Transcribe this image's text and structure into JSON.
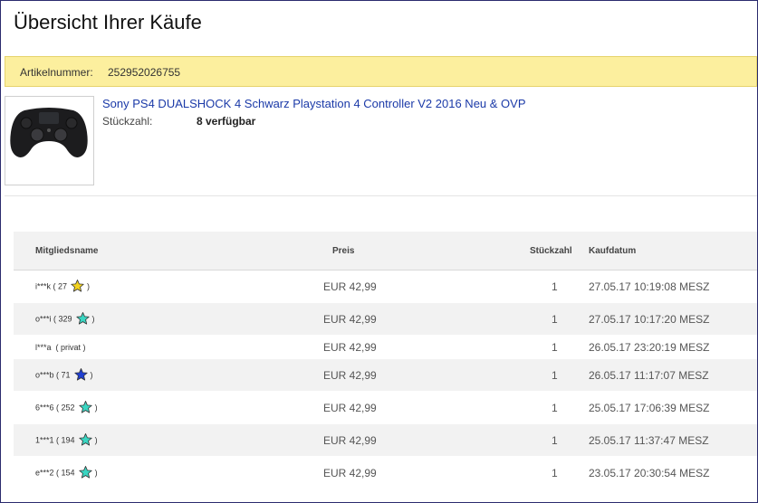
{
  "page": {
    "title": "Übersicht Ihrer Käufe"
  },
  "item": {
    "label": "Artikelnummer:",
    "number": "252952026755"
  },
  "product": {
    "title": "Sony PS4 DUALSHOCK 4 Schwarz Playstation 4 Controller V2 2016 Neu & OVP",
    "qty_label": "Stückzahl:",
    "qty_value": "8 verfügbar"
  },
  "table": {
    "headers": {
      "member": "Mitgliedsname",
      "price": "Preis",
      "qty": "Stückzahl",
      "date": "Kaufdatum"
    },
    "rows": [
      {
        "member": "i***k",
        "score": "27",
        "star": "yellow",
        "price": "EUR 42,99",
        "qty": "1",
        "date": "27.05.17 10:19:08 MESZ"
      },
      {
        "member": "o***i",
        "score": "329",
        "star": "turquoise",
        "price": "EUR 42,99",
        "qty": "1",
        "date": "27.05.17 10:17:20 MESZ"
      },
      {
        "member": "l***a",
        "score": "privat",
        "star": "",
        "price": "EUR 42,99",
        "qty": "1",
        "date": "26.05.17 23:20:19 MESZ"
      },
      {
        "member": "o***b",
        "score": "71",
        "star": "blue",
        "price": "EUR 42,99",
        "qty": "1",
        "date": "26.05.17 11:17:07 MESZ"
      },
      {
        "member": "6***6",
        "score": "252",
        "star": "turquoise",
        "price": "EUR 42,99",
        "qty": "1",
        "date": "25.05.17 17:06:39 MESZ"
      },
      {
        "member": "1***1",
        "score": "194",
        "star": "turquoise",
        "price": "EUR 42,99",
        "qty": "1",
        "date": "25.05.17 11:37:47 MESZ"
      },
      {
        "member": "e***2",
        "score": "154",
        "star": "turquoise",
        "price": "EUR 42,99",
        "qty": "1",
        "date": "23.05.17 20:30:54 MESZ"
      }
    ]
  },
  "colors": {
    "yellow": "#f2d21f",
    "turquoise": "#3ad6c2",
    "blue": "#1f3fd1",
    "banner": "#fcef9e",
    "link": "#1b3aa8"
  }
}
